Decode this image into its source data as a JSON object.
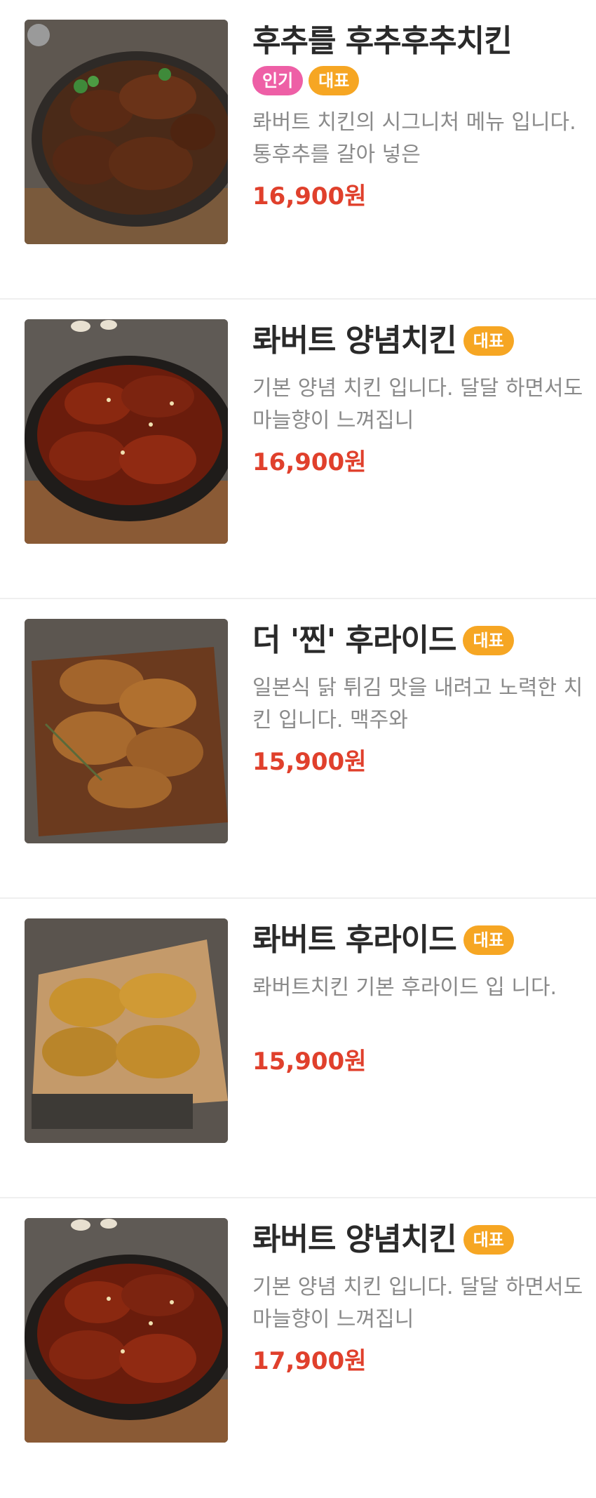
{
  "menu": [
    {
      "name": "후추를 후추후추치킨",
      "badges": [
        "인기",
        "대표"
      ],
      "description": "롸버트 치킨의 시그니처 메뉴 입니다. 통후추를 갈아 넣은",
      "price": "16,900원",
      "image": "pepper-chicken-photo"
    },
    {
      "name": "롸버트 양념치킨",
      "badges": [
        "대표"
      ],
      "description": "기본 양념 치킨 입니다. 달달 하면서도 마늘향이 느껴집니",
      "price": "16,900원",
      "image": "seasoned-chicken-photo"
    },
    {
      "name": "더 '찐' 후라이드",
      "badges": [
        "대표"
      ],
      "description": "일본식 닭 튀김 맛을 내려고 노력한 치킨 입니다. 맥주와",
      "price": "15,900원",
      "image": "japanese-fried-chicken-photo"
    },
    {
      "name": "롸버트 후라이드",
      "badges": [
        "대표"
      ],
      "description": "롸버트치킨 기본 후라이드 입 니다.",
      "price": "15,900원",
      "image": "fried-chicken-photo"
    },
    {
      "name": "롸버트 양념치킨",
      "badges": [
        "대표"
      ],
      "description": "기본 양념 치킨 입니다. 달달 하면서도 마늘향이 느껴집니",
      "price": "17,900원",
      "image": "seasoned-chicken-photo"
    }
  ],
  "colors": {
    "price": "#e0402c",
    "badge_popular": "#ee5fa6",
    "badge_signature": "#f6a623"
  }
}
